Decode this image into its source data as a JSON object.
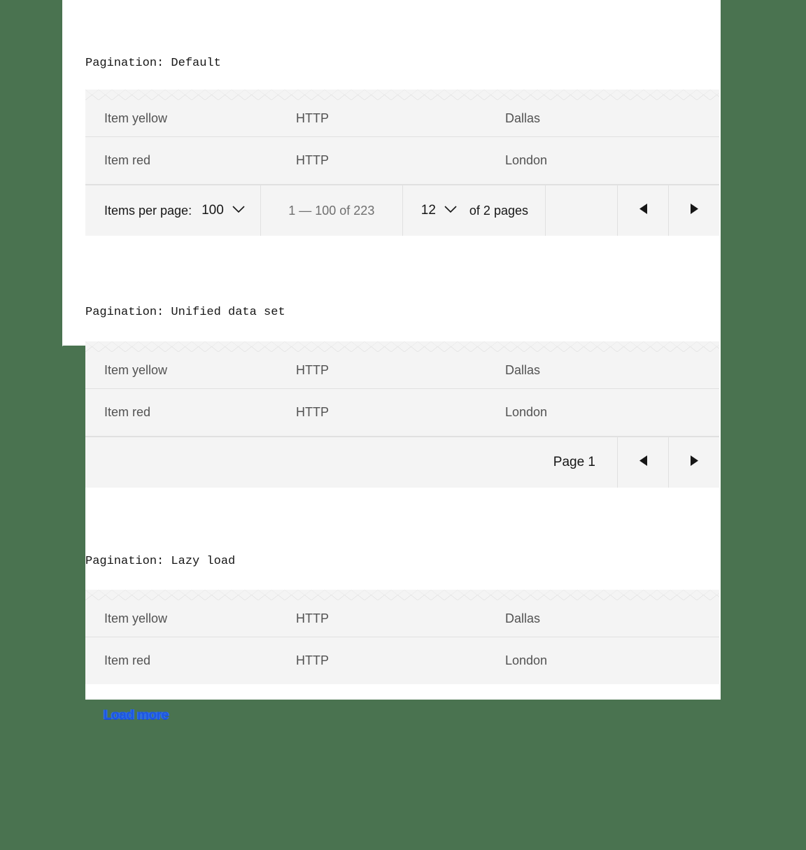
{
  "theme": {
    "background": "#4a7350",
    "sheet": "#ffffff",
    "table_bg": "#f4f4f4",
    "border": "#e0e0e0",
    "text_primary": "#161616",
    "text_secondary": "#525252",
    "text_muted": "#6f6f6f",
    "link": "#1f57e0"
  },
  "sections": [
    {
      "title": "Pagination: Default",
      "rows": [
        {
          "name": "Item yellow",
          "protocol": "HTTP",
          "city": "Dallas"
        },
        {
          "name": "Item red",
          "protocol": "HTTP",
          "city": "London"
        }
      ],
      "pagination": {
        "items_per_page_label": "Items per page:",
        "items_per_page_value": "100",
        "range_text": "1 — 100 of 223",
        "page_value": "12",
        "of_pages_text": "of 2 pages",
        "prev_icon": "caret-left-icon",
        "next_icon": "caret-right-icon",
        "chevron_icon": "chevron-down-icon"
      }
    },
    {
      "title": "Pagination: Unified data set",
      "rows": [
        {
          "name": "Item yellow",
          "protocol": "HTTP",
          "city": "Dallas"
        },
        {
          "name": "Item red",
          "protocol": "HTTP",
          "city": "London"
        }
      ],
      "pagination": {
        "page_text": "Page 1",
        "prev_icon": "caret-left-icon",
        "next_icon": "caret-right-icon"
      }
    },
    {
      "title": "Pagination: Lazy load",
      "rows": [
        {
          "name": "Item yellow",
          "protocol": "HTTP",
          "city": "Dallas"
        },
        {
          "name": "Item red",
          "protocol": "HTTP",
          "city": "London"
        }
      ],
      "load_more_label": "Load more"
    }
  ]
}
